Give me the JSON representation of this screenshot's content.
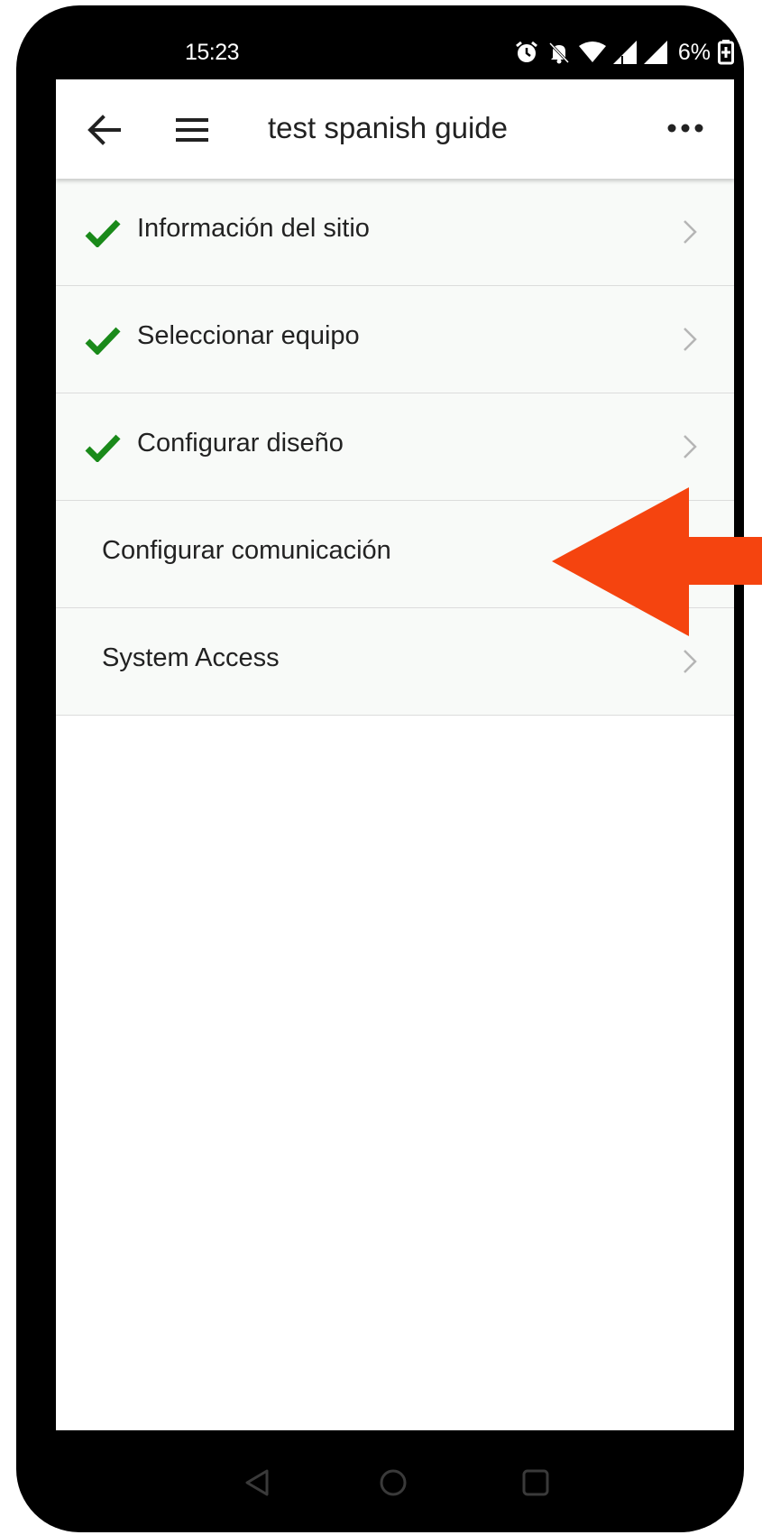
{
  "status_bar": {
    "time": "15:23",
    "battery": "6%",
    "icons": [
      "alarm-icon",
      "bell-off-icon",
      "wifi-icon",
      "signal-icon",
      "signal-icon",
      "battery-charging-icon"
    ]
  },
  "app_bar": {
    "title": "test spanish guide",
    "back_icon": "arrow-back-icon",
    "menu_icon": "hamburger-menu-icon",
    "more_icon": "more-dots-icon"
  },
  "steps": [
    {
      "label": "Información del sitio",
      "completed": true,
      "chevron": true
    },
    {
      "label": "Seleccionar equipo",
      "completed": true,
      "chevron": true
    },
    {
      "label": "Configurar diseño",
      "completed": true,
      "chevron": true
    },
    {
      "label": "Configurar comunicación",
      "completed": false,
      "chevron": false
    },
    {
      "label": "System Access",
      "completed": false,
      "chevron": true
    }
  ],
  "annotation": {
    "type": "arrow-left",
    "color": "#f5440f",
    "target": "Configurar comunicación"
  },
  "colors": {
    "check_green": "#1a8a1a",
    "row_background": "#f8faf8",
    "divider": "#dcdcdc",
    "chevron": "#b5b5b5"
  },
  "nav_bar": {
    "icons": [
      "nav-back-icon",
      "nav-home-icon",
      "nav-recents-icon"
    ]
  }
}
